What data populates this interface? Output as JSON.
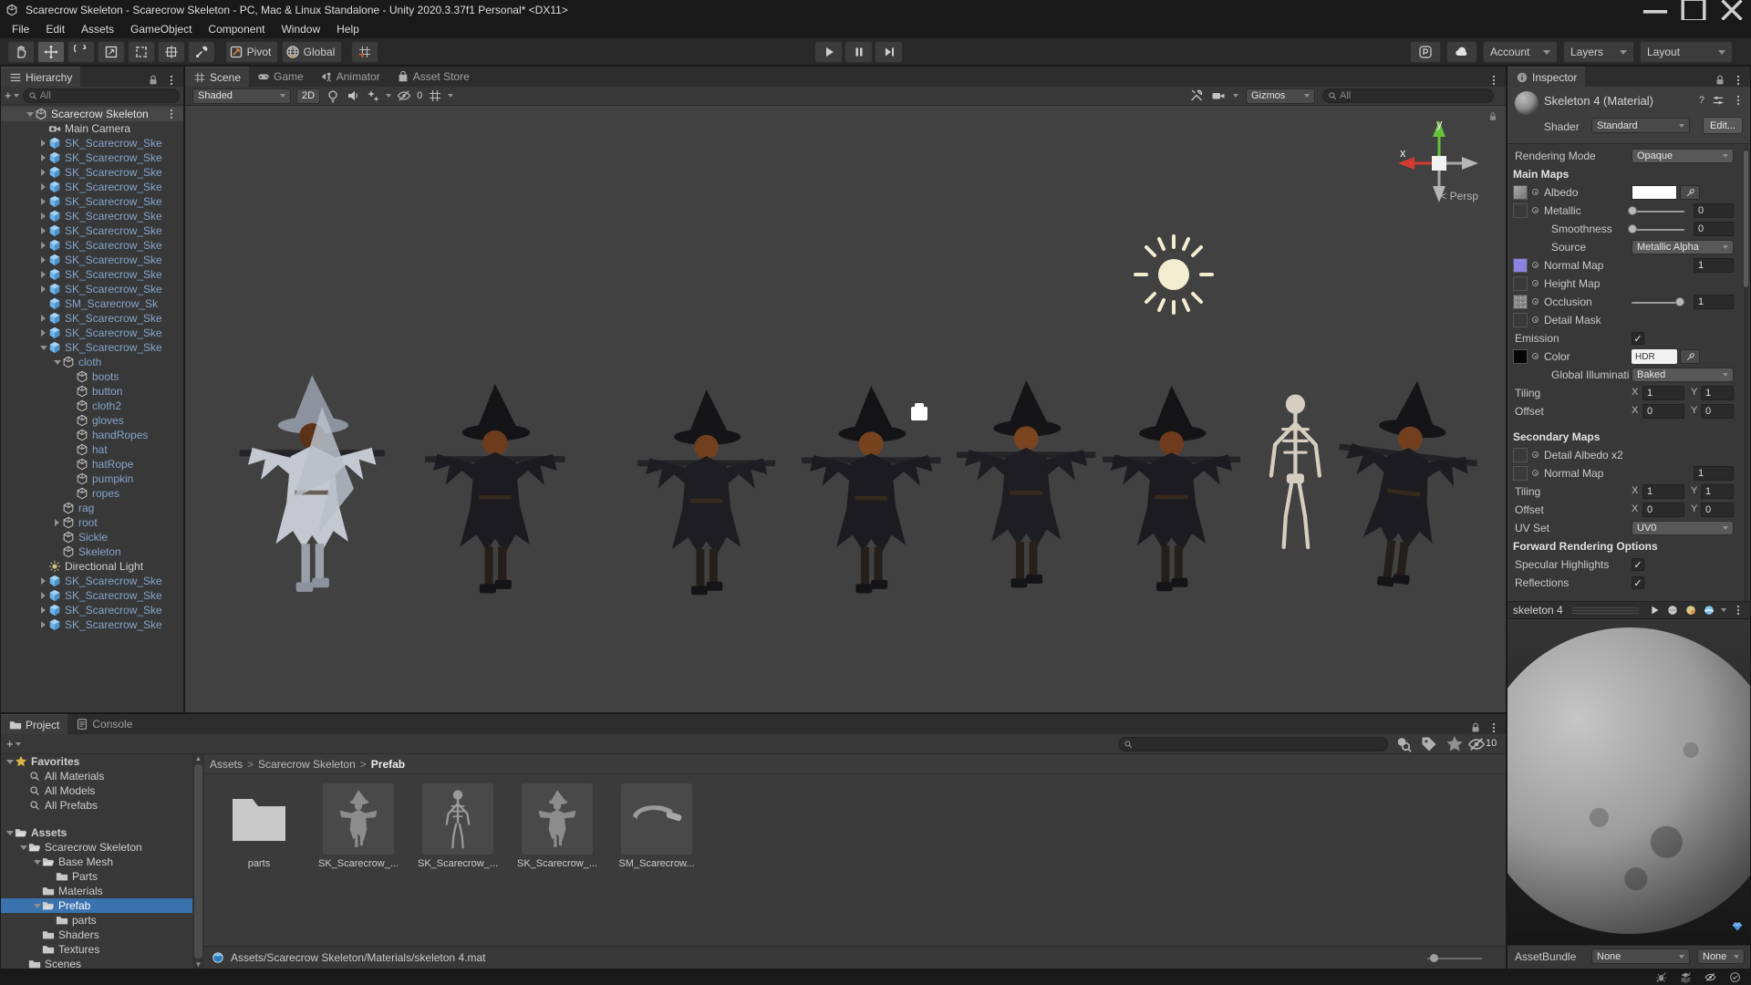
{
  "window": {
    "title": "Scarecrow Skeleton - Scarecrow Skeleton - PC, Mac & Linux Standalone - Unity 2020.3.37f1 Personal* <DX11>",
    "menus": [
      "File",
      "Edit",
      "Assets",
      "GameObject",
      "Component",
      "Window",
      "Help"
    ]
  },
  "toolbar": {
    "tools": [
      "hand",
      "move",
      "rotate",
      "scale",
      "rect",
      "transform",
      "custom"
    ],
    "selected_tool": "move",
    "pivot_label": "Pivot",
    "global_label": "Global",
    "account_label": "Account",
    "layers_label": "Layers",
    "layout_label": "Layout"
  },
  "hierarchy": {
    "tab": "Hierarchy",
    "search_placeholder": "All",
    "items": [
      {
        "label": "Scarecrow Skeleton",
        "icon": "unity",
        "arrow": "down",
        "indent": 0,
        "root": true
      },
      {
        "label": "Main Camera",
        "icon": "camera",
        "indent": 1
      },
      {
        "label": "SK_Scarecrow_Ske",
        "icon": "cube-blue",
        "arrow": "right",
        "indent": 1,
        "prefab": true
      },
      {
        "label": "SK_Scarecrow_Ske",
        "icon": "cube-blue",
        "arrow": "right",
        "indent": 1,
        "prefab": true
      },
      {
        "label": "SK_Scarecrow_Ske",
        "icon": "cube-blue",
        "arrow": "right",
        "indent": 1,
        "prefab": true
      },
      {
        "label": "SK_Scarecrow_Ske",
        "icon": "cube-blue",
        "arrow": "right",
        "indent": 1,
        "prefab": true
      },
      {
        "label": "SK_Scarecrow_Ske",
        "icon": "cube-blue",
        "arrow": "right",
        "indent": 1,
        "prefab": true
      },
      {
        "label": "SK_Scarecrow_Ske",
        "icon": "cube-blue",
        "arrow": "right",
        "indent": 1,
        "prefab": true
      },
      {
        "label": "SK_Scarecrow_Ske",
        "icon": "cube-blue",
        "arrow": "right",
        "indent": 1,
        "prefab": true
      },
      {
        "label": "SK_Scarecrow_Ske",
        "icon": "cube-blue",
        "arrow": "right",
        "indent": 1,
        "prefab": true
      },
      {
        "label": "SK_Scarecrow_Ske",
        "icon": "cube-blue",
        "arrow": "right",
        "indent": 1,
        "prefab": true
      },
      {
        "label": "SK_Scarecrow_Ske",
        "icon": "cube-blue",
        "arrow": "right",
        "indent": 1,
        "prefab": true
      },
      {
        "label": "SK_Scarecrow_Ske",
        "icon": "cube-blue",
        "arrow": "right",
        "indent": 1,
        "prefab": true
      },
      {
        "label": "SM_Scarecrow_Sk",
        "icon": "cube-blue",
        "indent": 1,
        "prefab": true
      },
      {
        "label": "SK_Scarecrow_Ske",
        "icon": "cube-blue",
        "arrow": "right",
        "indent": 1,
        "prefab": true
      },
      {
        "label": "SK_Scarecrow_Ske",
        "icon": "cube-blue",
        "arrow": "right",
        "indent": 1,
        "prefab": true
      },
      {
        "label": "SK_Scarecrow_Ske",
        "icon": "cube-blue",
        "arrow": "down",
        "indent": 1,
        "prefab": true
      },
      {
        "label": "cloth",
        "icon": "cube-gray",
        "arrow": "down",
        "indent": 2,
        "prefab": true
      },
      {
        "label": "boots",
        "icon": "cube-gray",
        "indent": 3,
        "prefab": true
      },
      {
        "label": "button",
        "icon": "cube-gray",
        "indent": 3,
        "prefab": true
      },
      {
        "label": "cloth2",
        "icon": "cube-gray",
        "indent": 3,
        "prefab": true
      },
      {
        "label": "gloves",
        "icon": "cube-gray",
        "indent": 3,
        "prefab": true
      },
      {
        "label": "handRopes",
        "icon": "cube-gray",
        "indent": 3,
        "prefab": true
      },
      {
        "label": "hat",
        "icon": "cube-gray",
        "indent": 3,
        "prefab": true
      },
      {
        "label": "hatRope",
        "icon": "cube-gray",
        "indent": 3,
        "prefab": true
      },
      {
        "label": "pumpkin",
        "icon": "cube-gray",
        "indent": 3,
        "prefab": true
      },
      {
        "label": "ropes",
        "icon": "cube-gray",
        "indent": 3,
        "prefab": true
      },
      {
        "label": "rag",
        "icon": "cube-gray",
        "indent": 2,
        "prefab": true
      },
      {
        "label": "root",
        "icon": "cube-gray",
        "arrow": "right",
        "indent": 2,
        "prefab": true
      },
      {
        "label": "Sickle",
        "icon": "cube-gray",
        "indent": 2,
        "prefab": true
      },
      {
        "label": "Skeleton",
        "icon": "cube-gray",
        "indent": 2,
        "prefab": true
      },
      {
        "label": "Directional Light",
        "icon": "light",
        "indent": 1
      },
      {
        "label": "SK_Scarecrow_Ske",
        "icon": "cube-blue",
        "arrow": "right",
        "indent": 1,
        "prefab": true
      },
      {
        "label": "SK_Scarecrow_Ske",
        "icon": "cube-blue",
        "arrow": "right",
        "indent": 1,
        "prefab": true
      },
      {
        "label": "SK_Scarecrow_Ske",
        "icon": "cube-blue",
        "arrow": "right",
        "indent": 1,
        "prefab": true
      },
      {
        "label": "SK_Scarecrow_Ske",
        "icon": "cube-blue",
        "arrow": "right",
        "indent": 1,
        "prefab": true
      }
    ]
  },
  "scene": {
    "tabs": [
      "Scene",
      "Game",
      "Animator",
      "Asset Store"
    ],
    "active_tab": "Scene",
    "shaded_label": "Shaded",
    "mode_2d": "2D",
    "effects_count": "0",
    "gizmos_label": "Gizmos",
    "search_placeholder": "All",
    "persp_label": "Persp",
    "axis_x_label": "x",
    "axis_y_label": "y"
  },
  "inspector": {
    "tab": "Inspector",
    "title": "Skeleton 4 (Material)",
    "shader_label": "Shader",
    "shader_value": "Standard",
    "edit_button": "Edit...",
    "properties": [
      {
        "label": "Rendering Mode",
        "control": "dropdown",
        "value": "Opaque"
      },
      {
        "label": "Main Maps",
        "header": true
      },
      {
        "label": "Albedo",
        "dot": true,
        "swatch": "gray",
        "control": "color"
      },
      {
        "label": "Metallic",
        "dot": true,
        "swatch": "empty",
        "control": "slider",
        "slider": 0,
        "value": "0"
      },
      {
        "label": "Smoothness",
        "indent": 1,
        "control": "slider",
        "slider": 0,
        "value": "0"
      },
      {
        "label": "Source",
        "indent": 1,
        "control": "dropdown",
        "value": "Metallic Alpha"
      },
      {
        "label": "Normal Map",
        "dot": true,
        "swatch": "purple",
        "control": "field",
        "value": "1"
      },
      {
        "label": "Height Map",
        "dot": true,
        "swatch": "empty"
      },
      {
        "label": "Occlusion",
        "dot": true,
        "swatch": "texture",
        "control": "slider",
        "slider": 1,
        "value": "1"
      },
      {
        "label": "Detail Mask",
        "dot": true,
        "swatch": "empty"
      },
      {
        "label": "Emission",
        "control": "checkbox",
        "checked": true
      },
      {
        "label": "Color",
        "dot": true,
        "swatch": "black",
        "control": "hdr",
        "hdr_label": "HDR"
      },
      {
        "label": "Global Illuminati",
        "indent": 1,
        "control": "dropdown",
        "value": "Baked"
      },
      {
        "label": "Tiling",
        "control": "xy",
        "x_label": "X",
        "x": "1",
        "y_label": "Y",
        "y": "1"
      },
      {
        "label": "Offset",
        "control": "xy",
        "x_label": "X",
        "x": "0",
        "y_label": "Y",
        "y": "0"
      },
      {
        "label": "Secondary Maps",
        "header": true,
        "gap": true
      },
      {
        "label": "Detail Albedo x2",
        "dot": true,
        "swatch": "empty"
      },
      {
        "label": "Normal Map",
        "dot": true,
        "swatch": "empty",
        "control": "field",
        "value": "1"
      },
      {
        "label": "Tiling",
        "control": "xy",
        "x_label": "X",
        "x": "1",
        "y_label": "Y",
        "y": "1"
      },
      {
        "label": "Offset",
        "control": "xy",
        "x_label": "X",
        "x": "0",
        "y_label": "Y",
        "y": "0"
      },
      {
        "label": "UV Set",
        "control": "dropdown",
        "value": "UV0"
      },
      {
        "label": "Forward Rendering Options",
        "header": true
      },
      {
        "label": "Specular Highlights",
        "control": "checkbox",
        "checked": true
      },
      {
        "label": "Reflections",
        "control": "checkbox",
        "checked": true
      }
    ],
    "preview_name": "skeleton 4",
    "assetbundle_label": "AssetBundle",
    "assetbundle_value": "None",
    "assetbundle_variant": "None"
  },
  "project": {
    "tabs": [
      "Project",
      "Console"
    ],
    "active_tab": "Project",
    "hidden_count": "10",
    "tree": [
      {
        "label": "Favorites",
        "icon": "star",
        "arrow": "down",
        "indent": 0,
        "bold": true
      },
      {
        "label": "All Materials",
        "icon": "search",
        "indent": 1
      },
      {
        "label": "All Models",
        "icon": "search",
        "indent": 1
      },
      {
        "label": "All Prefabs",
        "icon": "search",
        "indent": 1
      },
      {
        "spacer": true
      },
      {
        "label": "Assets",
        "icon": "folder-open",
        "arrow": "down",
        "indent": 0,
        "bold": true
      },
      {
        "label": "Scarecrow Skeleton",
        "icon": "folder-open",
        "arrow": "down",
        "indent": 1
      },
      {
        "label": "Base Mesh",
        "icon": "folder-open",
        "arrow": "down",
        "indent": 2
      },
      {
        "label": "Parts",
        "icon": "folder",
        "indent": 3
      },
      {
        "label": "Materials",
        "icon": "folder",
        "indent": 2
      },
      {
        "label": "Prefab",
        "icon": "folder-open",
        "arrow": "down",
        "indent": 2,
        "selected": true
      },
      {
        "label": "parts",
        "icon": "folder",
        "indent": 3
      },
      {
        "label": "Shaders",
        "icon": "folder",
        "indent": 2
      },
      {
        "label": "Textures",
        "icon": "folder",
        "indent": 2
      },
      {
        "label": "Scenes",
        "icon": "folder",
        "indent": 1
      }
    ],
    "breadcrumb": [
      "Assets",
      "Scarecrow Skeleton",
      "Prefab"
    ],
    "items": [
      {
        "label": "parts",
        "kind": "folder"
      },
      {
        "label": "SK_Scarecrow_...",
        "kind": "scarecrow"
      },
      {
        "label": "SK_Scarecrow_...",
        "kind": "skeleton"
      },
      {
        "label": "SK_Scarecrow_...",
        "kind": "scarecrow"
      },
      {
        "label": "SM_Scarecrow...",
        "kind": "sickle"
      }
    ],
    "status_path": "Assets/Scarecrow Skeleton/Materials/skeleton 4.mat"
  },
  "colors": {
    "selection": "#3a72ae",
    "prefab_text": "#84a5cc",
    "axis_x": "#d23b30",
    "axis_y": "#67c23a",
    "sun_gizmo": "#f2ecd0",
    "scene_background": "#414141"
  }
}
